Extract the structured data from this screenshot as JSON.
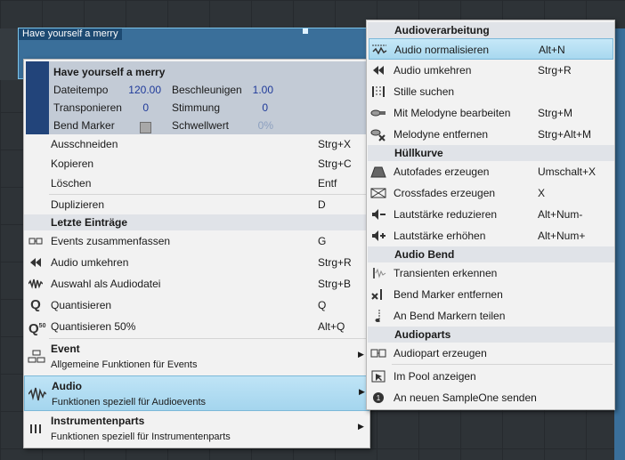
{
  "event": {
    "title": "Have yourself a merry"
  },
  "infobox": {
    "title": "Have yourself a merry",
    "rows": [
      {
        "label1": "Dateitempo",
        "val1": "120.00",
        "label2": "Beschleunigen",
        "val2": "1.00"
      },
      {
        "label1": "Transponieren",
        "val1": "0",
        "label2": "Stimmung",
        "val2": "0"
      },
      {
        "label1": "Bend Marker",
        "val1": "",
        "label2": "Schwellwert",
        "val2": "0%"
      }
    ]
  },
  "context_menu": {
    "items": [
      {
        "label": "Ausschneiden",
        "shortcut": "Strg+X"
      },
      {
        "label": "Kopieren",
        "shortcut": "Strg+C"
      },
      {
        "label": "Löschen",
        "shortcut": "Entf"
      },
      {
        "label": "Duplizieren",
        "shortcut": "D"
      }
    ],
    "recent_header": "Letzte Einträge",
    "recent": [
      {
        "label": "Events zusammenfassen",
        "shortcut": "G",
        "icon": "merge-icon"
      },
      {
        "label": "Audio umkehren",
        "shortcut": "Strg+R",
        "icon": "reverse-icon"
      },
      {
        "label": "Auswahl als Audiodatei",
        "shortcut": "Strg+B",
        "icon": "waveform-icon"
      },
      {
        "label": "Quantisieren",
        "shortcut": "Q",
        "icon": "quantize-icon"
      },
      {
        "label": "Quantisieren 50%",
        "shortcut": "Alt+Q",
        "icon": "quantize-50-icon"
      }
    ],
    "groups": [
      {
        "title": "Event",
        "subtitle": "Allgemeine Funktionen für Events"
      },
      {
        "title": "Audio",
        "subtitle": "Funktionen speziell für Audioevents"
      },
      {
        "title": "Instrumentenparts",
        "subtitle": "Funktionen speziell für Instrumentenparts"
      }
    ]
  },
  "submenu": {
    "sections": [
      {
        "header": "Audioverarbeitung",
        "items": [
          {
            "label": "Audio normalisieren",
            "shortcut": "Alt+N",
            "icon": "normalize-icon",
            "highlighted": true
          },
          {
            "label": "Audio umkehren",
            "shortcut": "Strg+R",
            "icon": "reverse-icon"
          },
          {
            "label": "Stille suchen",
            "shortcut": "",
            "icon": "silence-icon"
          },
          {
            "label": "Mit Melodyne bearbeiten",
            "shortcut": "Strg+M",
            "icon": "melodyne-icon"
          },
          {
            "label": "Melodyne entfernen",
            "shortcut": "Strg+Alt+M",
            "icon": "melodyne-remove-icon"
          }
        ]
      },
      {
        "header": "Hüllkurve",
        "items": [
          {
            "label": "Autofades erzeugen",
            "shortcut": "Umschalt+X",
            "icon": "autofade-icon"
          },
          {
            "label": "Crossfades erzeugen",
            "shortcut": "X",
            "icon": "crossfade-icon"
          },
          {
            "label": "Lautstärke reduzieren",
            "shortcut": "Alt+Num-",
            "icon": "volume-down-icon"
          },
          {
            "label": "Lautstärke erhöhen",
            "shortcut": "Alt+Num+",
            "icon": "volume-up-icon"
          }
        ]
      },
      {
        "header": "Audio Bend",
        "items": [
          {
            "label": "Transienten erkennen",
            "shortcut": "",
            "icon": "transient-icon"
          },
          {
            "label": "Bend Marker entfernen",
            "shortcut": "",
            "icon": "bend-remove-icon"
          },
          {
            "label": "An Bend Markern teilen",
            "shortcut": "",
            "icon": "bend-split-icon"
          }
        ]
      },
      {
        "header": "Audioparts",
        "items": [
          {
            "label": "Audiopart erzeugen",
            "shortcut": "",
            "icon": "audiopart-icon"
          },
          {
            "label": "Im Pool anzeigen",
            "shortcut": "",
            "icon": "pool-icon"
          },
          {
            "label": "An neuen SampleOne senden",
            "shortcut": "",
            "icon": "sampleone-icon"
          }
        ]
      }
    ]
  },
  "colors": {
    "highlight": "#a8d8ef",
    "infobox_value": "#1f3a9a",
    "event_fill": "#3a6f9a"
  }
}
